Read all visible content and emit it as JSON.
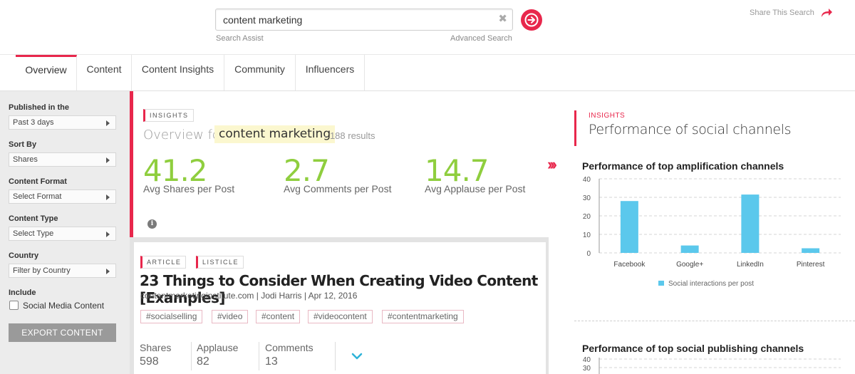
{
  "search": {
    "query": "content marketing",
    "clear_icon": "close-icon",
    "assist_label": "Search Assist",
    "advanced_label": "Advanced Search",
    "share_label": "Share This Search",
    "go_icon": "arrow-right-circle-icon",
    "share_icon": "share-arrow-icon"
  },
  "tabs": [
    {
      "label": "Overview",
      "active": true
    },
    {
      "label": "Content",
      "active": false
    },
    {
      "label": "Content Insights",
      "active": false
    },
    {
      "label": "Community",
      "active": false
    },
    {
      "label": "Influencers",
      "active": false
    }
  ],
  "filters": {
    "published": {
      "label": "Published in the",
      "value": "Past 3 days"
    },
    "sort": {
      "label": "Sort By",
      "value": "Shares"
    },
    "format": {
      "label": "Content Format",
      "value": "Select Format"
    },
    "type": {
      "label": "Content Type",
      "value": "Select Type"
    },
    "country": {
      "label": "Country",
      "value": "Filter by Country"
    },
    "include": {
      "label": "Include",
      "option": "Social Media Content",
      "checked": false
    },
    "export_label": "EXPORT CONTENT"
  },
  "overview": {
    "tag": "INSIGHTS",
    "title": "Overview for",
    "query": "content marketing",
    "results": "- 188 results",
    "metrics": [
      {
        "value": "41.2",
        "label": "Avg Shares per Post"
      },
      {
        "value": "2.7",
        "label": "Avg Comments per Post"
      },
      {
        "value": "14.7",
        "label": "Avg Applause per Post"
      }
    ],
    "accent_color": "#e8274c",
    "metric_color": "#8fce3e"
  },
  "article": {
    "tags": [
      "ARTICLE",
      "LISTICLE"
    ],
    "title": "23 Things to Consider When Creating Video Content [Examples]",
    "meta": "contentmarketinginstitute.com  |  Jodi Harris  |  Apr 12, 2016",
    "hashtags": [
      "#socialselling",
      "#video",
      "#content",
      "#videocontent",
      "#contentmarketing"
    ],
    "stats": [
      {
        "label": "Shares",
        "value": "598"
      },
      {
        "label": "Applause",
        "value": "82"
      },
      {
        "label": "Comments",
        "value": "13"
      }
    ]
  },
  "social": {
    "kicker": "INSIGHTS",
    "title": "Performance of social channels",
    "chart1_title": "Performance of top amplification channels",
    "chart2_title": "Performance of top social publishing channels"
  },
  "chart_data": [
    {
      "type": "bar",
      "title": "Performance of top amplification channels",
      "categories": [
        "Facebook",
        "Google+",
        "LinkedIn",
        "Pinterest"
      ],
      "series": [
        {
          "name": "Social interactions per post",
          "values": [
            28,
            4,
            31.5,
            2.5
          ],
          "color": "#5bc8ec"
        }
      ],
      "yticks": [
        0,
        10,
        20,
        30,
        40
      ],
      "ylim": [
        0,
        40
      ],
      "grid": true,
      "legend": "bottom"
    },
    {
      "type": "bar",
      "title": "Performance of top social publishing channels",
      "categories": [],
      "series": [],
      "yticks": [
        30,
        40
      ],
      "ylim": [
        0,
        40
      ],
      "grid": true
    }
  ]
}
